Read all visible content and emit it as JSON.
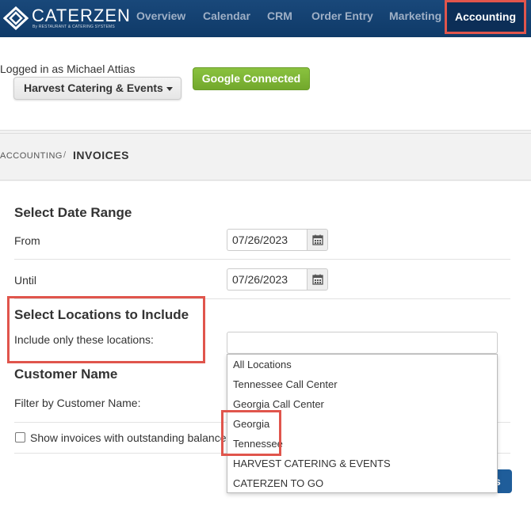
{
  "nav": {
    "brand": "CATERZEN",
    "brand_sub": "By RESTAURANT & CATERING SYSTEMS",
    "items": [
      "Overview",
      "Calendar",
      "CRM",
      "Order Entry",
      "Marketing"
    ],
    "active": "Accounting"
  },
  "header": {
    "logged_in": "Logged in as Michael Attias",
    "company": "Harvest Catering & Events",
    "google": "Google Connected"
  },
  "breadcrumb": {
    "parent": "ACCOUNTING",
    "separator": "/",
    "current": "INVOICES"
  },
  "date_range": {
    "title": "Select Date Range",
    "from_label": "From",
    "from_value": "07/26/2023",
    "until_label": "Until",
    "until_value": "07/26/2023"
  },
  "locations": {
    "title": "Select Locations to Include",
    "label": "Include only these locations:",
    "input_value": "",
    "options": [
      "All Locations",
      "Tennessee Call Center",
      "Georgia Call Center",
      "Georgia",
      "Tennessee",
      "HARVEST CATERING & EVENTS",
      "CATERZEN TO GO"
    ]
  },
  "customer": {
    "title": "Customer Name",
    "label": "Filter by Customer Name:"
  },
  "outstanding": {
    "label": "Show invoices with outstanding balance",
    "checked": false
  },
  "action_button": {
    "label_fragment": "s"
  },
  "colors": {
    "nav_bg": "#19487a",
    "highlight": "#e0554c",
    "google_green": "#7cb536",
    "action_blue": "#1f5d9a"
  },
  "icons": [
    "caterzen-logo-icon",
    "caret-down-icon",
    "calendar-icon"
  ]
}
